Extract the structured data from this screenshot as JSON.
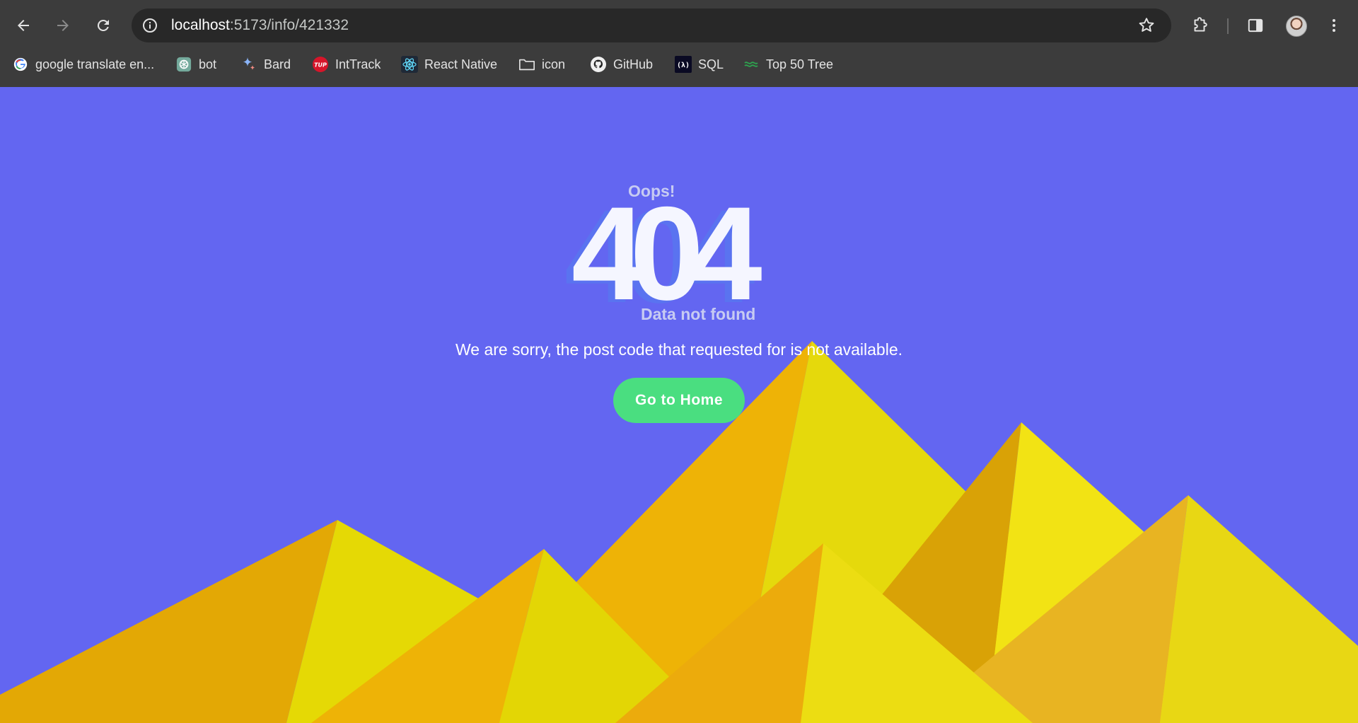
{
  "browser": {
    "back_icon": "arrow-left-icon",
    "forward_icon": "arrow-right-icon",
    "reload_icon": "reload-icon",
    "url_host": "localhost",
    "url_path": ":5173/info/421332",
    "site_info_icon": "info-icon",
    "bookmark_star_icon": "star-icon",
    "extensions_icon": "puzzle-icon",
    "side_panel_icon": "side-panel-icon",
    "menu_icon": "kebab-menu-icon"
  },
  "bookmarks": [
    {
      "label": "google translate en...",
      "icon": "google-icon"
    },
    {
      "label": "bot",
      "icon": "chatgpt-icon"
    },
    {
      "label": "Bard",
      "icon": "bard-sparkle-icon"
    },
    {
      "label": "IntTrack",
      "icon": "tup-logo-icon"
    },
    {
      "label": "React Native",
      "icon": "react-icon"
    },
    {
      "label": "icon",
      "icon": "folder-icon"
    },
    {
      "label": "GitHub",
      "icon": "github-icon"
    },
    {
      "label": "SQL",
      "icon": "freecodecamp-icon"
    },
    {
      "label": "Top 50 Tree",
      "icon": "tree-icon"
    }
  ],
  "page": {
    "oops": "Oops!",
    "code": "404",
    "subtitle": "Data not found",
    "message": "We are sorry, the post code that requested for is not available.",
    "button_label": "Go to Home"
  },
  "colors": {
    "background": "#6366f1",
    "button": "#4ade80",
    "mountain_dark": "#eaa70a",
    "mountain_light": "#e5d90c"
  }
}
